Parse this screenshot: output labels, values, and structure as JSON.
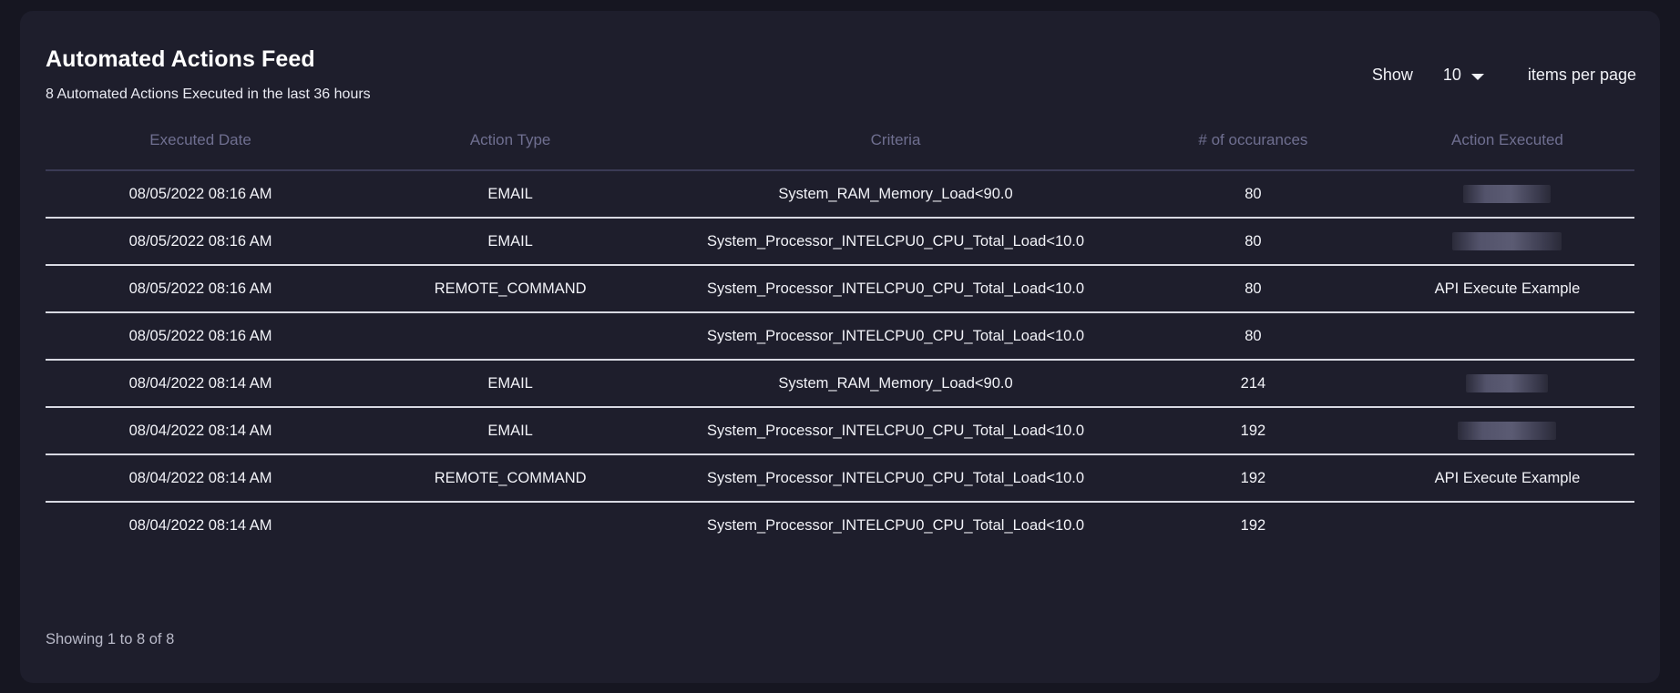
{
  "header": {
    "title": "Automated Actions Feed",
    "subtitle": "8 Automated Actions Executed in the last 36 hours",
    "page_size": {
      "label": "Show",
      "value": "10",
      "suffix": "items per page",
      "caret_icon": "chevron-down-icon"
    }
  },
  "table": {
    "columns": [
      "Executed Date",
      "Action Type",
      "Criteria",
      "# of occurances",
      "Action Executed"
    ],
    "rows": [
      {
        "date": "08/05/2022 08:16 AM",
        "action_type": "EMAIL",
        "criteria": "System_RAM_Memory_Load<90.0",
        "occurrences": "80",
        "action_executed": "",
        "redacted": true,
        "redacted_width": 96
      },
      {
        "date": "08/05/2022 08:16 AM",
        "action_type": "EMAIL",
        "criteria": "System_Processor_INTELCPU0_CPU_Total_Load<10.0",
        "occurrences": "80",
        "action_executed": "",
        "redacted": true,
        "redacted_width": 120
      },
      {
        "date": "08/05/2022 08:16 AM",
        "action_type": "REMOTE_COMMAND",
        "criteria": "System_Processor_INTELCPU0_CPU_Total_Load<10.0",
        "occurrences": "80",
        "action_executed": "API Execute Example",
        "redacted": false
      },
      {
        "date": "08/05/2022 08:16 AM",
        "action_type": "",
        "criteria": "System_Processor_INTELCPU0_CPU_Total_Load<10.0",
        "occurrences": "80",
        "action_executed": "",
        "redacted": false
      },
      {
        "date": "08/04/2022 08:14 AM",
        "action_type": "EMAIL",
        "criteria": "System_RAM_Memory_Load<90.0",
        "occurrences": "214",
        "action_executed": "",
        "redacted": true,
        "redacted_width": 90
      },
      {
        "date": "08/04/2022 08:14 AM",
        "action_type": "EMAIL",
        "criteria": "System_Processor_INTELCPU0_CPU_Total_Load<10.0",
        "occurrences": "192",
        "action_executed": "",
        "redacted": true,
        "redacted_width": 108
      },
      {
        "date": "08/04/2022 08:14 AM",
        "action_type": "REMOTE_COMMAND",
        "criteria": "System_Processor_INTELCPU0_CPU_Total_Load<10.0",
        "occurrences": "192",
        "action_executed": "API Execute Example",
        "redacted": false
      },
      {
        "date": "08/04/2022 08:14 AM",
        "action_type": "",
        "criteria": "System_Processor_INTELCPU0_CPU_Total_Load<10.0",
        "occurrences": "192",
        "action_executed": "",
        "redacted": false
      }
    ]
  },
  "footer": {
    "showing_text": "Showing 1 to 8 of 8"
  },
  "colors": {
    "page_background": "#161621",
    "card_background": "#1e1e2c",
    "text_primary": "#f2f3f8",
    "header_text": "#6f6f90",
    "row_divider": "#d8d9e2",
    "header_divider": "#3a3a55",
    "footer_text": "#b9bac9"
  }
}
